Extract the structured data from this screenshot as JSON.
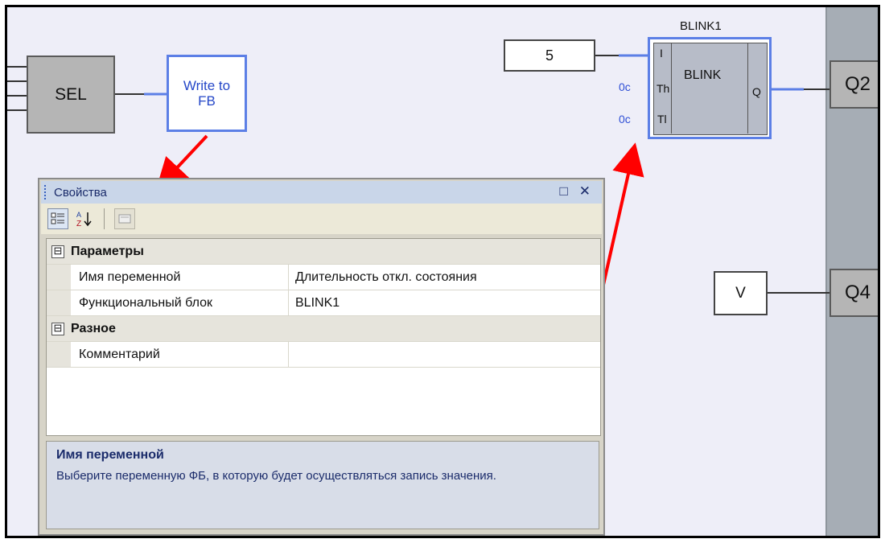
{
  "diagram": {
    "sel_label": "SEL",
    "write_fb_line1": "Write to",
    "write_fb_line2": "FB",
    "const_value": "5",
    "const_v": "V",
    "blink_instance": "BLINK1",
    "blink_type": "BLINK",
    "pin_i": "I",
    "pin_th": "Th",
    "pin_tl": "Tl",
    "pin_q": "Q",
    "th_value": "0c",
    "tl_value": "0c",
    "output_q2": "Q2",
    "output_q4": "Q4"
  },
  "panel": {
    "title": "Свойства",
    "restore_icon": "□",
    "close_icon": "✕",
    "toolbar": {
      "categorized_icon": "categorized-icon",
      "alphabetical_icon": "sort-az-icon",
      "pages_icon": "property-pages-icon"
    },
    "rows": [
      {
        "type": "category",
        "label": "Параметры",
        "expander": "⊟"
      },
      {
        "type": "property",
        "label": "Имя переменной",
        "value": "Длительность откл. состояния"
      },
      {
        "type": "property",
        "label": "Функциональный блок",
        "value": "BLINK1"
      },
      {
        "type": "category",
        "label": "Разное",
        "expander": "⊟"
      },
      {
        "type": "property",
        "label": "Комментарий",
        "value": ""
      }
    ],
    "help_title": "Имя переменной",
    "help_text": "Выберите переменную ФБ, в которую будет осуществляться запись значения."
  },
  "colors": {
    "canvas_bg": "#eeeef8",
    "selection_blue": "#5c7fe6",
    "annotation_red": "#ff0000",
    "rail_gray": "#a6adb5"
  }
}
